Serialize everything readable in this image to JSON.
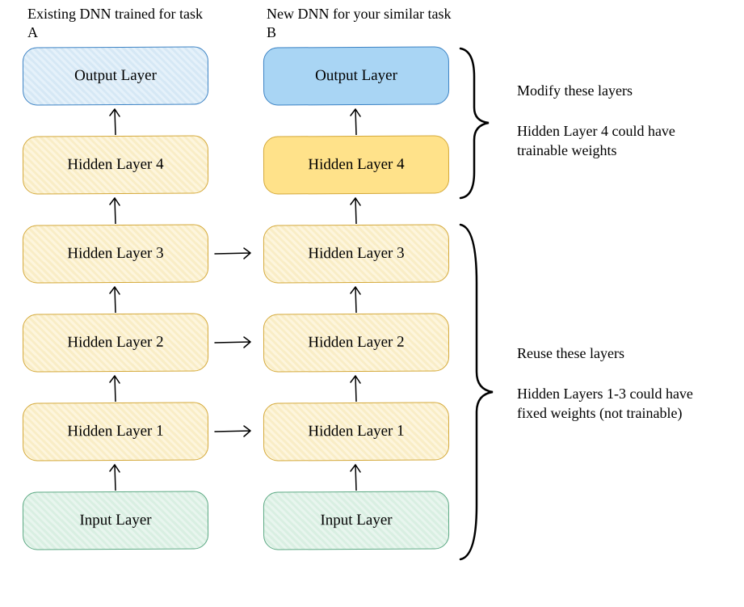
{
  "titleA": "Existing DNN trained for task A",
  "titleB": "New DNN for your similar task B",
  "layers": {
    "input": "Input Layer",
    "hidden1": "Hidden Layer 1",
    "hidden2": "Hidden Layer 2",
    "hidden3": "Hidden Layer 3",
    "hidden4": "Hidden Layer 4",
    "output": "Output Layer"
  },
  "annotations": {
    "modify": "Modify these layers",
    "trainable": "Hidden Layer 4 could have trainable weights",
    "reuse": "Reuse these layers",
    "fixed": "Hidden Layers 1-3 could have fixed weights (not trainable)"
  },
  "chart_data": {
    "type": "diagram",
    "description": "Transfer learning diagram showing two deep neural network stacks",
    "columns": [
      {
        "name": "Existing DNN trained for task A",
        "layers": [
          "Input Layer",
          "Hidden Layer 1",
          "Hidden Layer 2",
          "Hidden Layer 3",
          "Hidden Layer 4",
          "Output Layer"
        ]
      },
      {
        "name": "New DNN for your similar task B",
        "layers": [
          "Input Layer",
          "Hidden Layer 1",
          "Hidden Layer 2",
          "Hidden Layer 3",
          "Hidden Layer 4",
          "Output Layer"
        ]
      }
    ],
    "transfer_arrows": [
      {
        "from": "A.Hidden Layer 1",
        "to": "B.Hidden Layer 1"
      },
      {
        "from": "A.Hidden Layer 2",
        "to": "B.Hidden Layer 2"
      },
      {
        "from": "A.Hidden Layer 3",
        "to": "B.Hidden Layer 3"
      }
    ],
    "brace_groups": [
      {
        "layers": [
          "Output Layer",
          "Hidden Layer 4"
        ],
        "annotations": [
          "Modify these layers",
          "Hidden Layer 4 could have trainable weights"
        ]
      },
      {
        "layers": [
          "Hidden Layer 3",
          "Hidden Layer 2",
          "Hidden Layer 1",
          "Input Layer"
        ],
        "annotations": [
          "Reuse these layers",
          "Hidden Layers 1-3 could have fixed weights (not trainable)"
        ]
      }
    ]
  }
}
